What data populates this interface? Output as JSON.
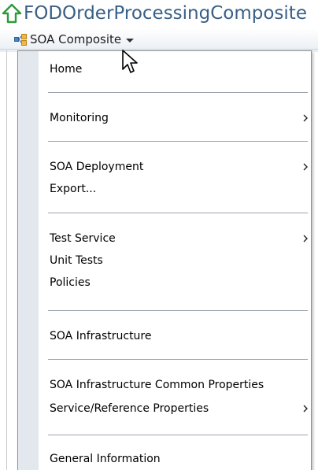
{
  "page_title": "FODOrderProcessingComposite",
  "menu_button": {
    "label": "SOA Composite",
    "icon": "composite-icon"
  },
  "menu": {
    "items": [
      {
        "label": "Home",
        "submenu": false
      },
      {
        "label": "Monitoring",
        "submenu": true
      },
      {
        "label": "SOA Deployment",
        "submenu": true
      },
      {
        "label": "Export...",
        "submenu": false
      },
      {
        "label": "Test Service",
        "submenu": true
      },
      {
        "label": "Unit Tests",
        "submenu": false
      },
      {
        "label": "Policies",
        "submenu": false
      },
      {
        "label": "SOA Infrastructure",
        "submenu": false
      },
      {
        "label": "SOA Infrastructure Common Properties",
        "submenu": false
      },
      {
        "label": "Service/Reference Properties",
        "submenu": true
      },
      {
        "label": "General Information",
        "submenu": false
      }
    ]
  },
  "colors": {
    "title": "#3a5f86",
    "home_icon": "#2e9a3a",
    "gutter": "#e3e8ee"
  }
}
